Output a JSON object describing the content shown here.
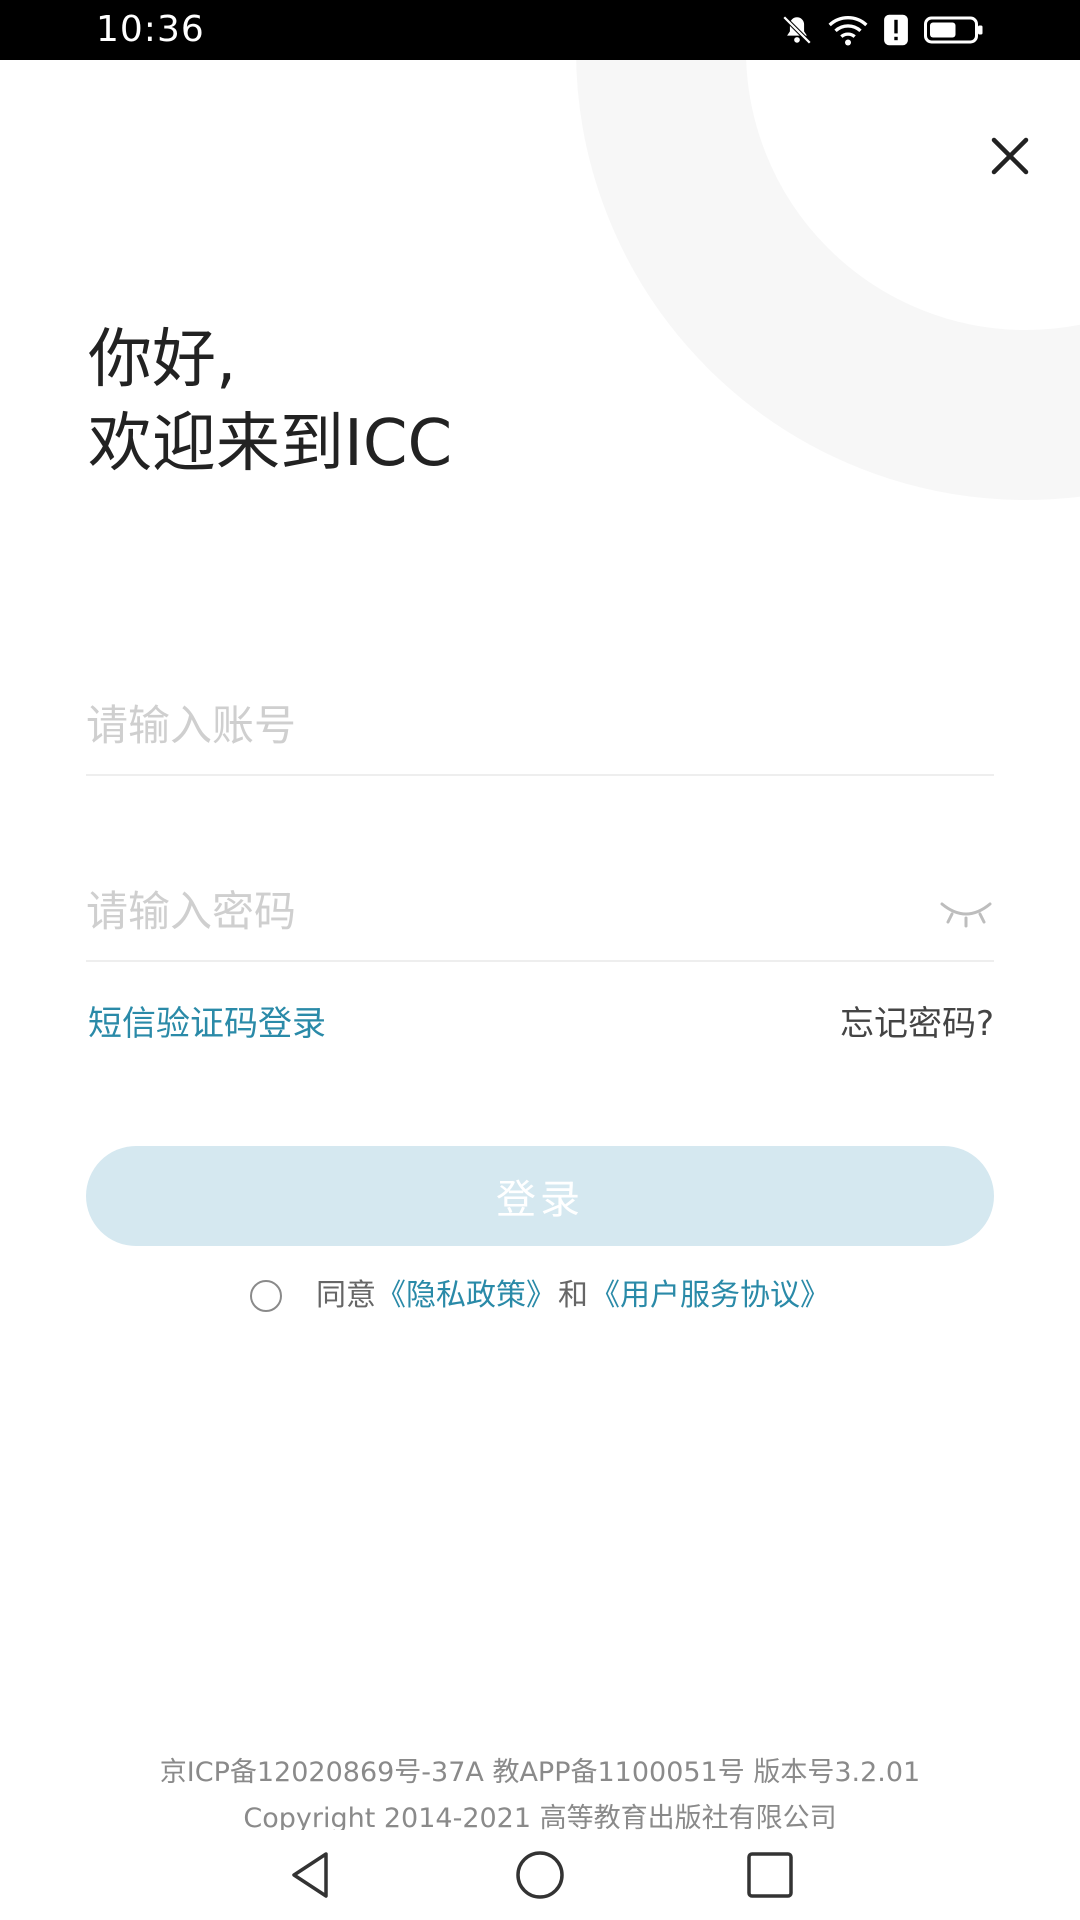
{
  "status_bar": {
    "time": "10:36",
    "icons": [
      "bell-off-icon",
      "wifi-icon",
      "alert-icon",
      "battery-icon"
    ]
  },
  "login": {
    "greeting_line1": "你好,",
    "greeting_line2": "欢迎来到ICC",
    "account_placeholder": "请输入账号",
    "account_value": "",
    "password_placeholder": "请输入密码",
    "password_value": "",
    "sms_login_label": "短信验证码登录",
    "forgot_password_label": "忘记密码?",
    "login_button_label": "登录",
    "agree_prefix": "同意",
    "privacy_policy_label": "《隐私政策》",
    "and_label": "和",
    "user_agreement_label": "《用户服务协议》"
  },
  "footer": {
    "line1": "京ICP备12020869号-37A  教APP备1100051号  版本号3.2.01",
    "line2": "Copyright 2014-2021 高等教育出版社有限公司"
  },
  "colors": {
    "accent": "#2a8aa8",
    "button_disabled": "#d5e8f0",
    "status_bar": "#000000"
  }
}
